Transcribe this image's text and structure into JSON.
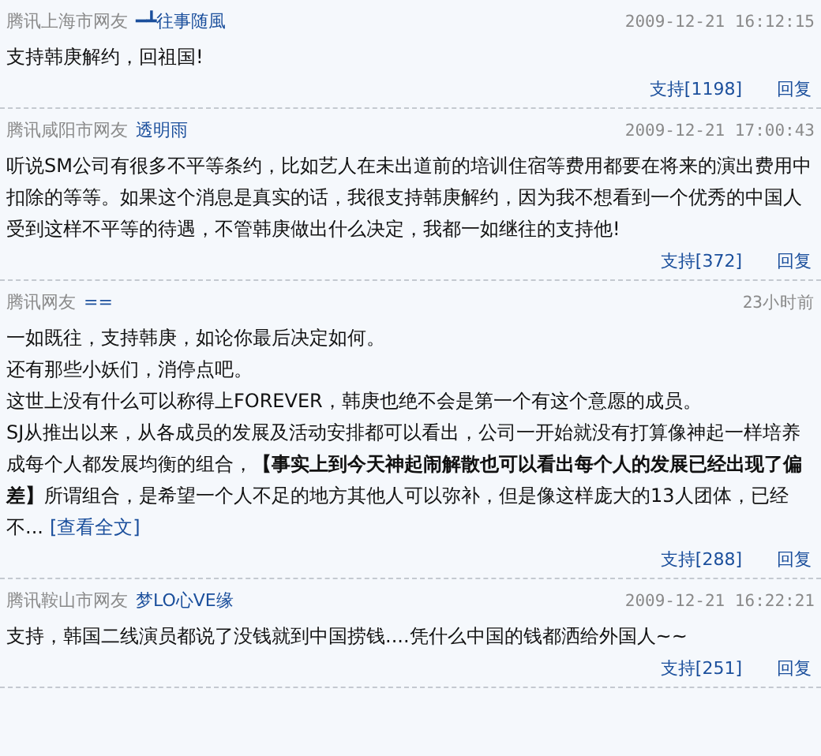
{
  "comments": [
    {
      "source": "腾讯上海市网友",
      "user": "━┻往事随風",
      "time": "2009-12-21 16:12:15",
      "paragraphs": [
        "支持韩庚解约，回祖国!"
      ],
      "support": "支持[1198]",
      "reply": "回复"
    },
    {
      "source": "腾讯咸阳市网友",
      "user": "透明雨",
      "time": "2009-12-21 17:00:43",
      "paragraphs": [
        "听说SM公司有很多不平等条约，比如艺人在未出道前的培训住宿等费用都要在将来的演出费用中扣除的等等。如果这个消息是真实的话，我很支持韩庚解约，因为我不想看到一个优秀的中国人受到这样不平等的待遇，不管韩庚做出什么决定，我都一如继往的支持他!"
      ],
      "support": "支持[372]",
      "reply": "回复"
    },
    {
      "source": "腾讯网友",
      "user": "==",
      "time": "23小时前",
      "paragraphs": [
        "一如既往，支持韩庚，如论你最后决定如何。",
        "还有那些小妖们，消停点吧。",
        "这世上没有什么可以称得上FOREVER，韩庚也绝不会是第一个有这个意愿的成员。",
        "SJ从推出以来，从各成员的发展及活动安排都可以看出，公司一开始就没有打算像神起一样培养成每个人都发展均衡的组合，**【事实上到今天神起闹解散也可以看出每个人的发展已经出现了偏差】**所谓组合，是希望一个人不足的地方其他人可以弥补，但是像这样庞大的13人团体，已经不..."
      ],
      "more_link": "[查看全文]",
      "support": "支持[288]",
      "reply": "回复"
    },
    {
      "source": "腾讯鞍山市网友",
      "user": "梦LO心VE缘",
      "time": "2009-12-21 16:22:21",
      "paragraphs": [
        "支持，韩国二线演员都说了没钱就到中国捞钱....凭什么中国的钱都洒给外国人~~"
      ],
      "support": "支持[251]",
      "reply": "回复"
    }
  ]
}
